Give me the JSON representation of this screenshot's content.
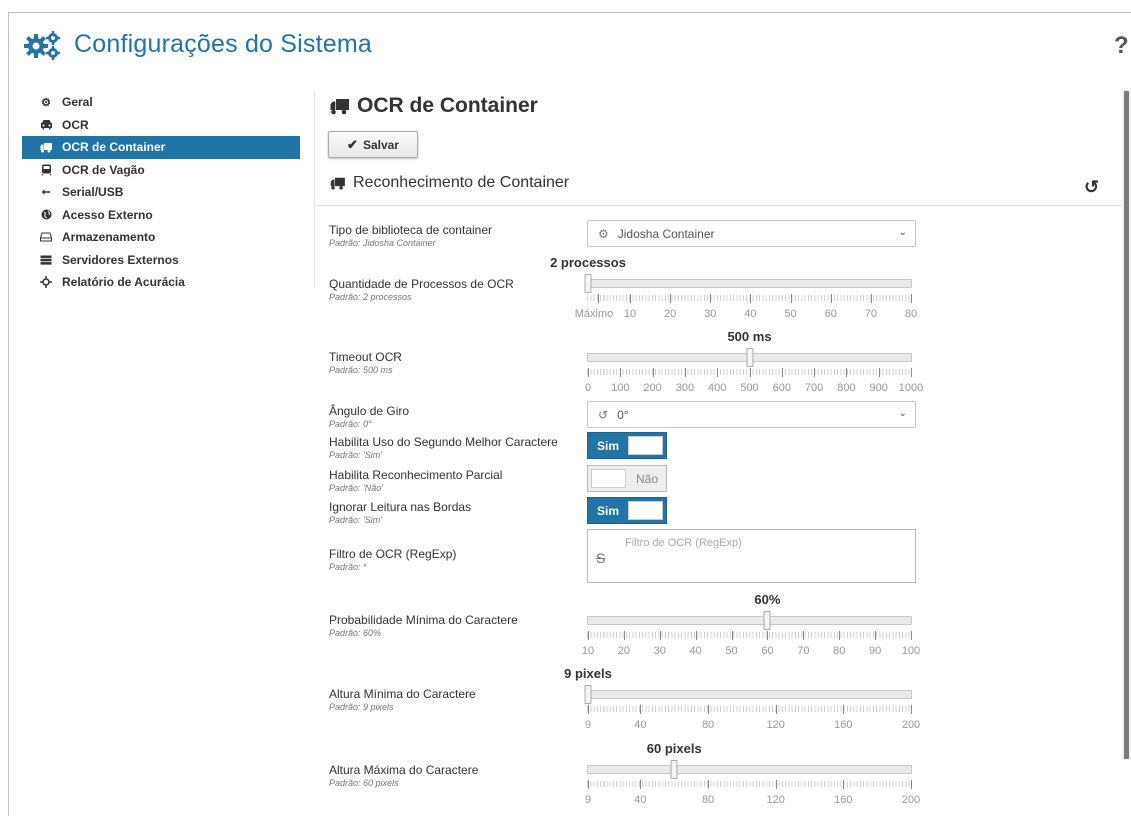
{
  "header": {
    "title": "Configurações do Sistema",
    "help_glyph": "?"
  },
  "sidebar": {
    "items": [
      {
        "label": "Geral",
        "icon": "cogs-icon"
      },
      {
        "label": "OCR",
        "icon": "car-icon"
      },
      {
        "label": "OCR de Container",
        "icon": "truck-icon",
        "active": true
      },
      {
        "label": "OCR de Vagão",
        "icon": "train-icon"
      },
      {
        "label": "Serial/USB",
        "icon": "usb-icon"
      },
      {
        "label": "Acesso Externo",
        "icon": "globe-icon"
      },
      {
        "label": "Armazenamento",
        "icon": "hdd-icon"
      },
      {
        "label": "Servidores Externos",
        "icon": "server-icon"
      },
      {
        "label": "Relatório de Acurácia",
        "icon": "crosshair-icon"
      }
    ]
  },
  "main": {
    "title": "OCR de Container",
    "save_label": "Salvar",
    "section_title": "Reconhecimento de Container",
    "fields": {
      "library": {
        "label": "Tipo de biblioteca de container",
        "default": "Padrão: Jidosha Container",
        "value": "Jidosha Container"
      },
      "processes": {
        "label": "Quantidade de Processos de OCR",
        "default": "Padrão: 2 processos",
        "value_label": "2 processos",
        "value": 2,
        "min": 2,
        "max": 80,
        "ticks": [
          "Máximo",
          "10",
          "20",
          "30",
          "40",
          "50",
          "60",
          "70",
          "80"
        ]
      },
      "timeout": {
        "label": "Timeout OCR",
        "default": "Padrão: 500 ms",
        "value_label": "500 ms",
        "value": 500,
        "min": 0,
        "max": 1000,
        "ticks": [
          "0",
          "100",
          "200",
          "300",
          "400",
          "500",
          "600",
          "700",
          "800",
          "900",
          "1000"
        ]
      },
      "angle": {
        "label": "Ângulo de Giro",
        "default": "Padrão: 0°",
        "value": "0°"
      },
      "second_best": {
        "label": "Habilita Uso do Segundo Melhor Caractere",
        "default": "Padrão: 'Sim'",
        "state": "Sim"
      },
      "partial": {
        "label": "Habilita Reconhecimento Parcial",
        "default": "Padrão: 'Não'",
        "state": "Não"
      },
      "borders": {
        "label": "Ignorar Leitura nas Bordas",
        "default": "Padrão: 'Sim'",
        "state": "Sim"
      },
      "regex": {
        "label": "Filtro de OCR (RegExp)",
        "default": "Padrão: *",
        "placeholder": "Filtro de OCR (RegExp)"
      },
      "probability": {
        "label": "Probabilidade Mínima do Caractere",
        "default": "Padrão: 60%",
        "value_label": "60%",
        "value": 60,
        "min": 10,
        "max": 100,
        "ticks": [
          "10",
          "20",
          "30",
          "40",
          "50",
          "60",
          "70",
          "80",
          "90",
          "100"
        ]
      },
      "min_height": {
        "label": "Altura Mínima do Caractere",
        "default": "Padrão: 9 pixels",
        "value_label": "9 pixels",
        "value": 9,
        "min": 9,
        "max": 200,
        "ticks": [
          "9",
          "40",
          "80",
          "120",
          "160",
          "200"
        ]
      },
      "max_height": {
        "label": "Altura Máxima do Caractere",
        "default": "Padrão: 60 pixels",
        "value_label": "60 pixels",
        "value": 60,
        "min": 9,
        "max": 200,
        "ticks": [
          "9",
          "40",
          "80",
          "120",
          "160",
          "200"
        ]
      }
    }
  },
  "colors": {
    "accent": "#2174a6"
  }
}
